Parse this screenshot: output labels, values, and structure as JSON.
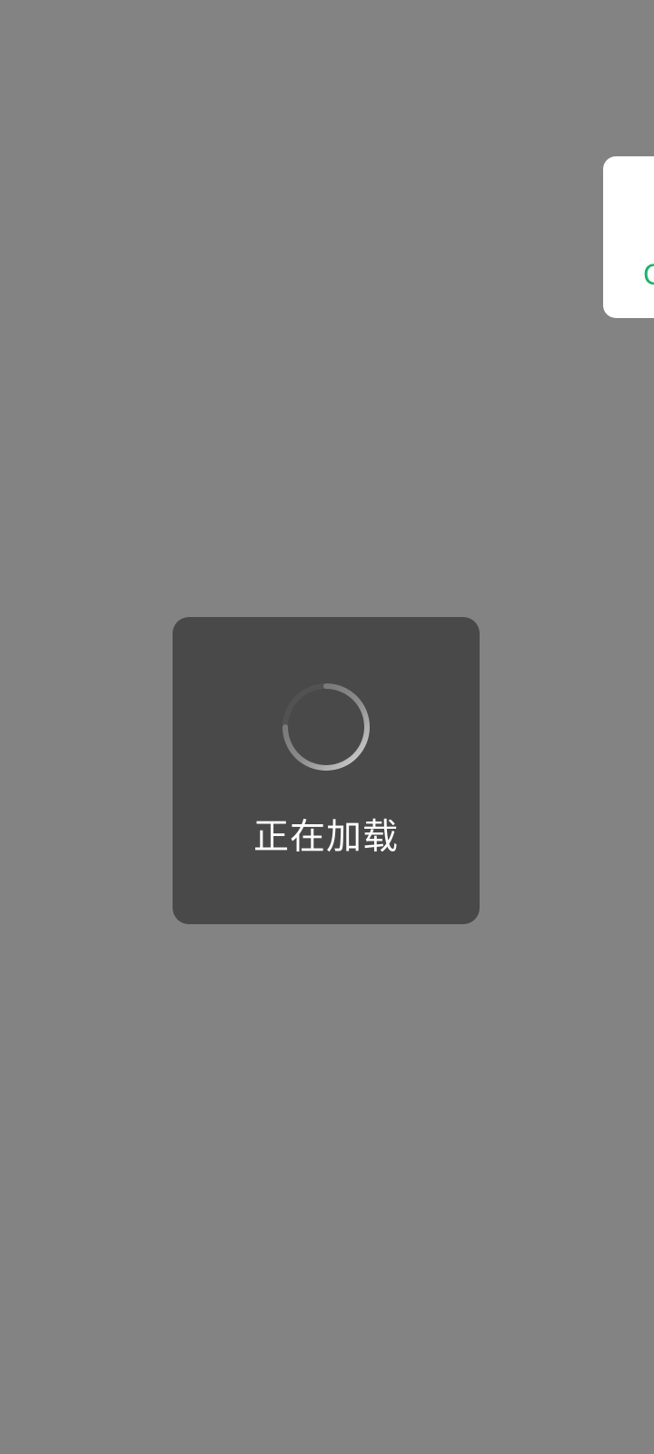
{
  "loading": {
    "label": "正在加载",
    "spinner_icon": "spinner-icon"
  },
  "edge_card": {
    "text": "C",
    "accent": "#1fb26a"
  },
  "colors": {
    "backdrop": "#838383",
    "toast_bg": "#4a4949",
    "toast_text": "#ffffff"
  }
}
